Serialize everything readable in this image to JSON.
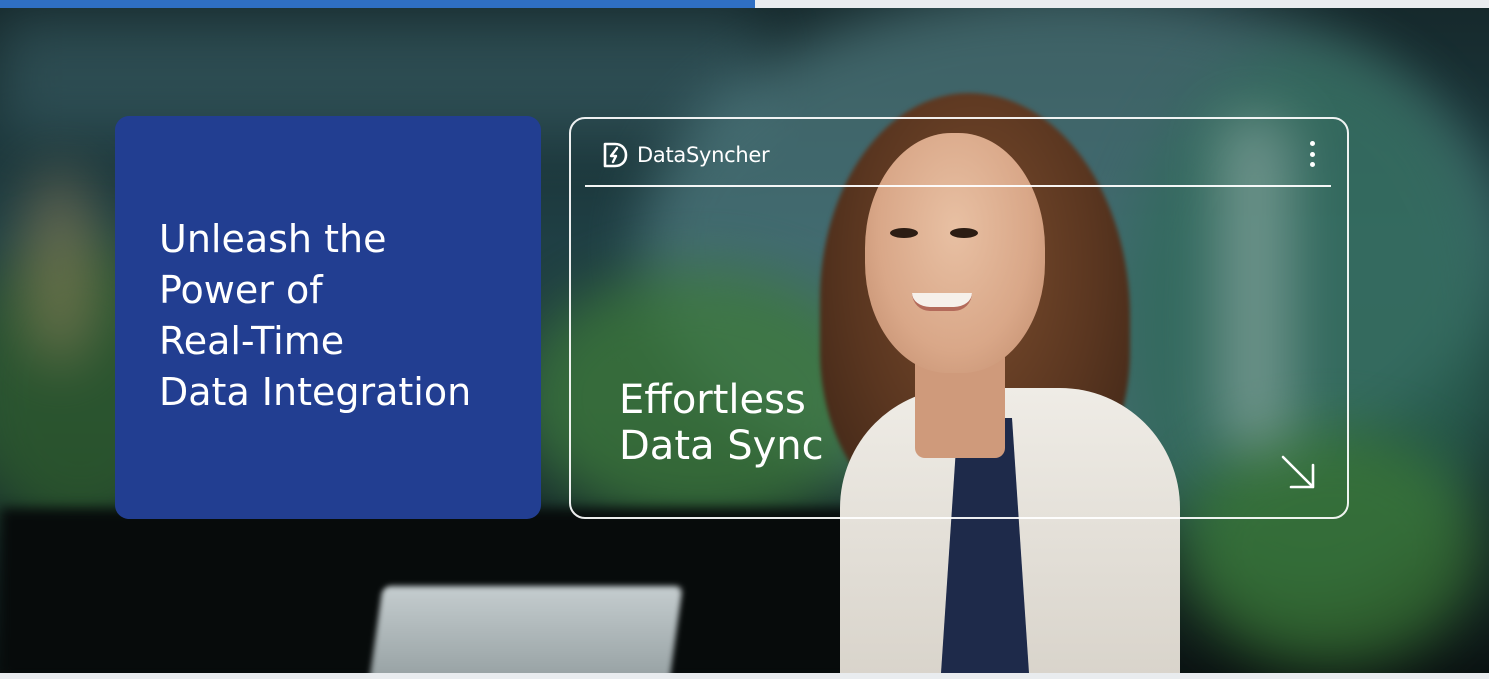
{
  "progress": {
    "fraction": 0.507
  },
  "hero": {
    "title_lines": [
      "Unleash the",
      "Power of",
      "Real-Time",
      "Data Integration"
    ]
  },
  "card": {
    "brand_name": "DataSyncher",
    "headline_lines": [
      "Effortless",
      "Data Sync"
    ]
  },
  "icons": {
    "brand": "datasyncher-logo-icon",
    "menu": "vertical-dots-icon",
    "arrow": "arrow-down-right-icon"
  },
  "colors": {
    "hero_card": "#223e91",
    "progress": "#2f6fc3",
    "text": "#ffffff"
  }
}
